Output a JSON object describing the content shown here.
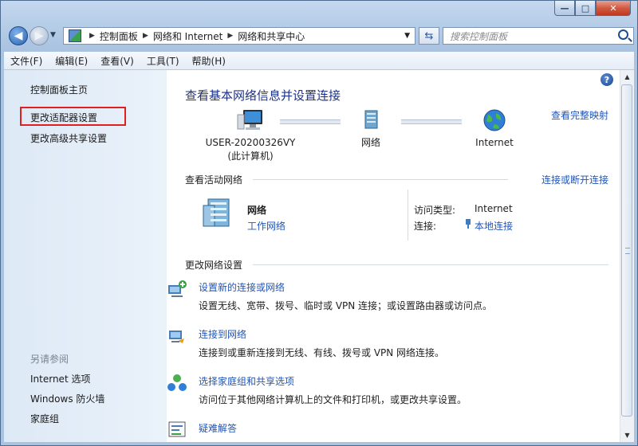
{
  "address_bar": {
    "crumbs": [
      "控制面板",
      "网络和 Internet",
      "网络和共享中心"
    ],
    "search_placeholder": "搜索控制面板"
  },
  "menu": [
    "文件(F)",
    "编辑(E)",
    "查看(V)",
    "工具(T)",
    "帮助(H)"
  ],
  "sidebar": {
    "items": [
      {
        "label": "控制面板主页"
      },
      {
        "label": "更改适配器设置",
        "highlighted": true
      },
      {
        "label": "更改高级共享设置"
      }
    ],
    "see_also_title": "另请参阅",
    "see_also": [
      "Internet 选项",
      "Windows 防火墙",
      "家庭组"
    ]
  },
  "main": {
    "title": "查看基本网络信息并设置连接",
    "full_map_link": "查看完整映射",
    "map_nodes": [
      {
        "label": "USER-20200326VY",
        "sublabel": "(此计算机)"
      },
      {
        "label": "网络"
      },
      {
        "label": "Internet"
      }
    ],
    "active_networks_title": "查看活动网络",
    "connect_disconnect_link": "连接或断开连接",
    "active_network": {
      "name": "网络",
      "type": "工作网络",
      "access_type_label": "访问类型:",
      "access_type_value": "Internet",
      "connections_label": "连接:",
      "connections_value": "本地连接"
    },
    "change_settings_title": "更改网络设置",
    "tasks": [
      {
        "title": "设置新的连接或网络",
        "desc": "设置无线、宽带、拨号、临时或 VPN 连接；或设置路由器或访问点。"
      },
      {
        "title": "连接到网络",
        "desc": "连接到或重新连接到无线、有线、拨号或 VPN 网络连接。"
      },
      {
        "title": "选择家庭组和共享选项",
        "desc": "访问位于其他网络计算机上的文件和打印机，或更改共享设置。"
      },
      {
        "title": "疑难解答",
        "desc": ""
      }
    ]
  },
  "colors": {
    "link": "#2155b8",
    "title": "#1e3287",
    "highlight_box": "#e0201f"
  }
}
